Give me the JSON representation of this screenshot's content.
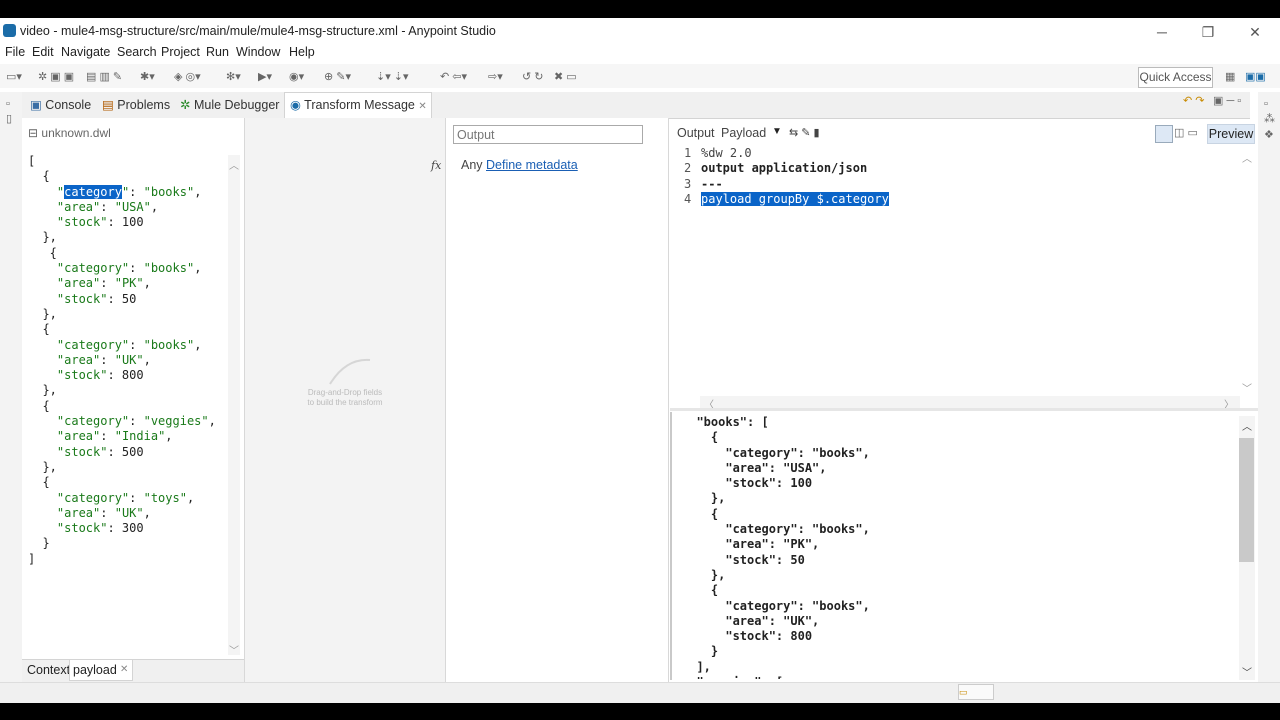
{
  "window": {
    "title": "video - mule4-msg-structure/src/main/mule/mule4-msg-structure.xml - Anypoint Studio",
    "minimize": "─",
    "restore": "❐",
    "close": "✕"
  },
  "menu": [
    "File",
    "Edit",
    "Navigate",
    "Search",
    "Project",
    "Run",
    "Window",
    "Help"
  ],
  "toolbar": {
    "quick_access": "Quick Access"
  },
  "tabs": [
    {
      "label": "Console",
      "icon": "console-icon"
    },
    {
      "label": "Problems",
      "icon": "problems-icon"
    },
    {
      "label": "Mule Debugger",
      "icon": "debugger-icon"
    },
    {
      "label": "Transform Message",
      "icon": "transform-icon",
      "active": true
    }
  ],
  "input_pane": {
    "file": "unknown.dwl",
    "lines": [
      "[",
      "  {",
      "    \"category\": \"books\",",
      "    \"area\": \"USA\",",
      "    \"stock\": 100",
      "  },",
      "   {",
      "    \"category\": \"books\",",
      "    \"area\": \"PK\",",
      "    \"stock\": 50",
      "  },",
      "  {",
      "    \"category\": \"books\",",
      "    \"area\": \"UK\",",
      "    \"stock\": 800",
      "  },",
      "  {",
      "    \"category\": \"veggies\",",
      "    \"area\": \"India\",",
      "    \"stock\": 500",
      "  },",
      "  {",
      "    \"category\": \"toys\",",
      "    \"area\": \"UK\",",
      "    \"stock\": 300",
      "  }",
      "]"
    ],
    "selected_word": "category",
    "bottom_tabs": [
      "Context",
      "payload"
    ]
  },
  "mapping_pane": {
    "hint_line1": "Drag-and-Drop fields",
    "hint_line2": "to build the transform"
  },
  "metadata_pane": {
    "output_placeholder": "Output",
    "fx": "fx",
    "any": "Any",
    "define_link": "Define metadata"
  },
  "script_header": {
    "output_label": "Output",
    "payload_label": "Payload",
    "preview_button": "Preview"
  },
  "script": [
    {
      "num": "1",
      "text": "%dw 2.0"
    },
    {
      "num": "2",
      "text": "output application/json"
    },
    {
      "num": "3",
      "text": "---"
    },
    {
      "num": "4",
      "text": "payload groupBy $.category",
      "selected": true
    }
  ],
  "preview": {
    "lines": [
      "  \"books\": [",
      "    {",
      "      \"category\": \"books\",",
      "      \"area\": \"USA\",",
      "      \"stock\": 100",
      "    },",
      "    {",
      "      \"category\": \"books\",",
      "      \"area\": \"PK\",",
      "      \"stock\": 50",
      "    },",
      "    {",
      "      \"category\": \"books\",",
      "      \"area\": \"UK\",",
      "      \"stock\": 800",
      "    }",
      "  ],",
      "  \"veggies\": ["
    ]
  },
  "colors": {
    "selection": "#0a64c8",
    "string": "#1a7a1a",
    "link": "#1a5fb4"
  }
}
